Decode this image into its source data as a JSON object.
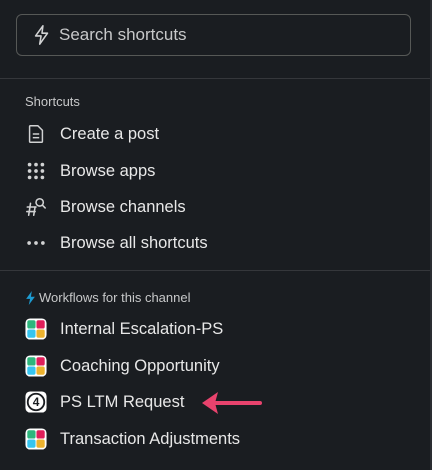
{
  "search": {
    "placeholder": "Search shortcuts",
    "icon": "lightning-icon"
  },
  "shortcuts": {
    "header": "Shortcuts",
    "items": [
      {
        "label": "Create a post",
        "icon": "document-icon"
      },
      {
        "label": "Browse apps",
        "icon": "grid-dots-icon"
      },
      {
        "label": "Browse channels",
        "icon": "channel-search-icon"
      },
      {
        "label": "Browse all shortcuts",
        "icon": "ellipsis-icon"
      }
    ]
  },
  "workflows": {
    "header": "Workflows for this channel",
    "header_icon": "lightning-icon",
    "items": [
      {
        "label": "Internal Escalation-PS",
        "icon": "workflow-app-icon"
      },
      {
        "label": "Coaching Opportunity",
        "icon": "workflow-app-icon"
      },
      {
        "label": "PS LTM Request",
        "icon": "number-four-icon"
      },
      {
        "label": "Transaction Adjustments",
        "icon": "workflow-app-icon"
      }
    ]
  },
  "colors": {
    "background": "#1a1d21",
    "text": "#e8e8e8",
    "muted_text": "#c7c8c9",
    "divider": "#35373b",
    "search_border": "#565856",
    "workflow_bolt": "#1d9bd1",
    "annotation_arrow": "#e8436d",
    "app_icon_green": "#2eb67d",
    "app_icon_red": "#e01e5a",
    "app_icon_blue": "#36c5f0",
    "app_icon_yellow": "#ecb22e"
  }
}
